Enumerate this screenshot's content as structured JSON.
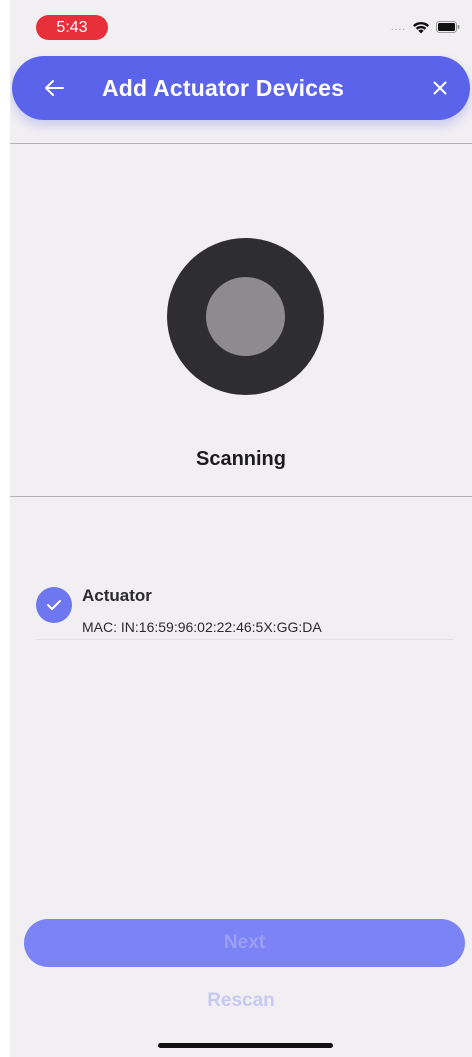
{
  "status_bar": {
    "time": "5:43",
    "signal_dots": "....",
    "icons": [
      "wifi-icon",
      "battery-icon"
    ]
  },
  "header": {
    "title": "Add Actuator Devices",
    "back_icon": "arrow-left-icon",
    "close_icon": "close-icon"
  },
  "scanner": {
    "status": "Scanning"
  },
  "devices": [
    {
      "name": "Actuator",
      "mac": "MAC: IN:16:59:96:02:22:46:5X:GG:DA",
      "selected": true
    }
  ],
  "actions": {
    "next_label": "Next",
    "rescan_label": "Rescan"
  },
  "colors": {
    "accent": "#5a63e9",
    "status_pill": "#e8303a",
    "background": "#f1eff2"
  }
}
